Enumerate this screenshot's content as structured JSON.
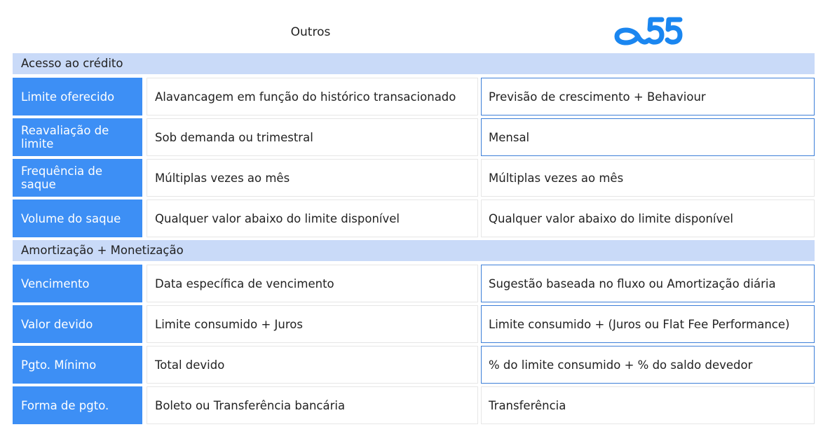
{
  "header": {
    "col_outros": "Outros",
    "logo_text": "o55",
    "logo_color": "#1a86f0"
  },
  "colors": {
    "section_bg": "#c9daf8",
    "label_bg": "#3d8ff5",
    "highlight_border": "#3d7fd8"
  },
  "sections": [
    {
      "title": "Acesso ao crédito",
      "rows": [
        {
          "label": "Limite oferecido",
          "outros": "Alavancagem em função do histórico transacionado",
          "o55": "Previsão de crescimento + Behaviour",
          "highlight": true
        },
        {
          "label": "Reavaliação de limite",
          "outros": "Sob demanda ou trimestral",
          "o55": "Mensal",
          "highlight": true
        },
        {
          "label": "Frequência de saque",
          "outros": "Múltiplas vezes ao mês",
          "o55": "Múltiplas vezes ao mês",
          "highlight": false
        },
        {
          "label": "Volume do saque",
          "outros": "Qualquer valor abaixo do limite disponível",
          "o55": "Qualquer valor abaixo do limite disponível",
          "highlight": false
        }
      ]
    },
    {
      "title": "Amortização + Monetização",
      "rows": [
        {
          "label": "Vencimento",
          "outros": "Data específica de vencimento",
          "o55": "Sugestão baseada no fluxo ou Amortização diária",
          "highlight": true
        },
        {
          "label": "Valor devido",
          "outros": "Limite consumido + Juros",
          "o55": "Limite consumido + (Juros ou Flat Fee Performance)",
          "highlight": true
        },
        {
          "label": "Pgto. Mínimo",
          "outros": "Total devido",
          "o55": "% do limite consumido + % do saldo devedor",
          "highlight": true
        },
        {
          "label": "Forma de pgto.",
          "outros": "Boleto ou Transferência bancária",
          "o55": "Transferência",
          "highlight": false
        }
      ]
    }
  ]
}
